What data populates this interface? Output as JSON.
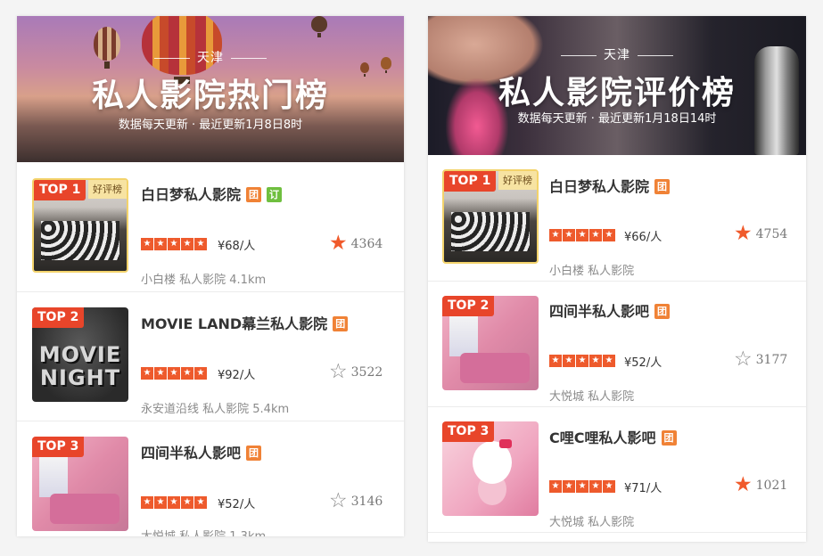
{
  "panels": [
    {
      "banner": {
        "city": "天津",
        "title": "私人影院热门榜",
        "subtitle": "数据每天更新 · 最近更新1月8日8时"
      },
      "items": [
        {
          "rank": "TOP 1",
          "praise_badge": "好评榜",
          "name": "白日梦私人影院",
          "tags": [
            "团",
            "订"
          ],
          "price": "¥68/人",
          "favorite_icon": "star-filled-icon",
          "favorites": "4364",
          "meta": "小白楼  私人影院  4.1km"
        },
        {
          "rank": "TOP 2",
          "praise_badge": "",
          "name": "MOVIE LAND幕兰私人影院",
          "tags": [
            "团"
          ],
          "price": "¥92/人",
          "favorite_icon": "star-outline-icon",
          "favorites": "3522",
          "meta": "永安道沿线  私人影院  5.4km",
          "thumb_text": [
            "MOVIE",
            "NIGHT"
          ]
        },
        {
          "rank": "TOP 3",
          "praise_badge": "",
          "name": "四间半私人影吧",
          "tags": [
            "团"
          ],
          "price": "¥52/人",
          "favorite_icon": "star-outline-icon",
          "favorites": "3146",
          "meta": "大悦城  私人影院  1.3km"
        }
      ]
    },
    {
      "banner": {
        "city": "天津",
        "title": "私人影院评价榜",
        "subtitle": "数据每天更新 · 最近更新1月18日14时"
      },
      "items": [
        {
          "rank": "TOP 1",
          "praise_badge": "好评榜",
          "name": "白日梦私人影院",
          "tags": [
            "团"
          ],
          "price": "¥66/人",
          "favorite_icon": "star-filled-icon",
          "favorites": "4754",
          "meta": "小白楼  私人影院"
        },
        {
          "rank": "TOP 2",
          "praise_badge": "",
          "name": "四间半私人影吧",
          "tags": [
            "团"
          ],
          "price": "¥52/人",
          "favorite_icon": "star-outline-icon",
          "favorites": "3177",
          "meta": "大悦城  私人影院"
        },
        {
          "rank": "TOP 3",
          "praise_badge": "",
          "name": "C哩C哩私人影吧",
          "tags": [
            "团"
          ],
          "price": "¥71/人",
          "favorite_icon": "star-filled-icon",
          "favorites": "1021",
          "meta": "大悦城  私人影院"
        }
      ]
    }
  ],
  "rating_stars": 5,
  "colors": {
    "accent": "#e8452a",
    "star": "#ee5a2c",
    "tag_tuan": "#f08236",
    "tag_ding": "#6fbf3f",
    "praise": "#f7e3a2"
  }
}
